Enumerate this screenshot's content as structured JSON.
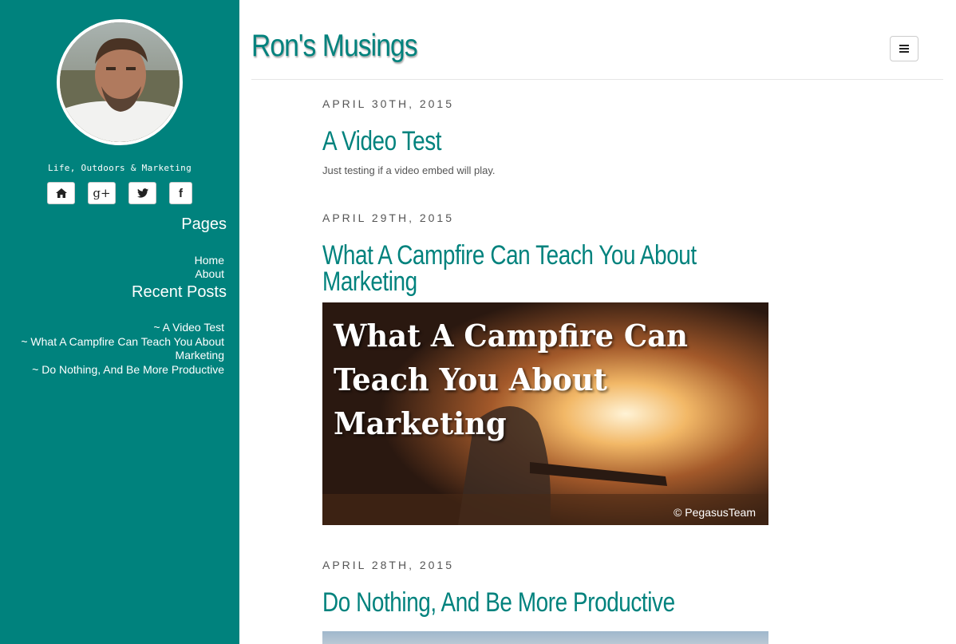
{
  "site": {
    "title": "Ron's Musings"
  },
  "sidebar": {
    "tagline": "Life, Outdoors & Marketing",
    "social": [
      {
        "icon": "home-icon"
      },
      {
        "icon": "google-plus-icon",
        "glyph": "g+"
      },
      {
        "icon": "twitter-icon"
      },
      {
        "icon": "facebook-icon",
        "glyph": "f"
      }
    ],
    "pages_heading": "Pages",
    "pages": [
      "Home",
      "About"
    ],
    "recent_heading": "Recent Posts",
    "recent": [
      "~ A Video Test",
      "~ What A Campfire Can Teach You About Marketing",
      "~ Do Nothing, And Be More Productive"
    ]
  },
  "posts": [
    {
      "date": "APRIL 30TH, 2015",
      "title": "A Video Test",
      "excerpt": "Just testing if a video embed will play."
    },
    {
      "date": "APRIL 29TH, 2015",
      "title": "What A Campfire Can Teach You About Marketing",
      "image_text_line1": "What A Campfire Can",
      "image_text_line2": "Teach You About",
      "image_text_line3": "Marketing",
      "image_credit": "© PegasusTeam"
    },
    {
      "date": "APRIL 28TH, 2015",
      "title": "Do Nothing, And Be More Productive"
    }
  ],
  "colors": {
    "accent": "#00827d",
    "sidebar_bg": "#00827d"
  }
}
